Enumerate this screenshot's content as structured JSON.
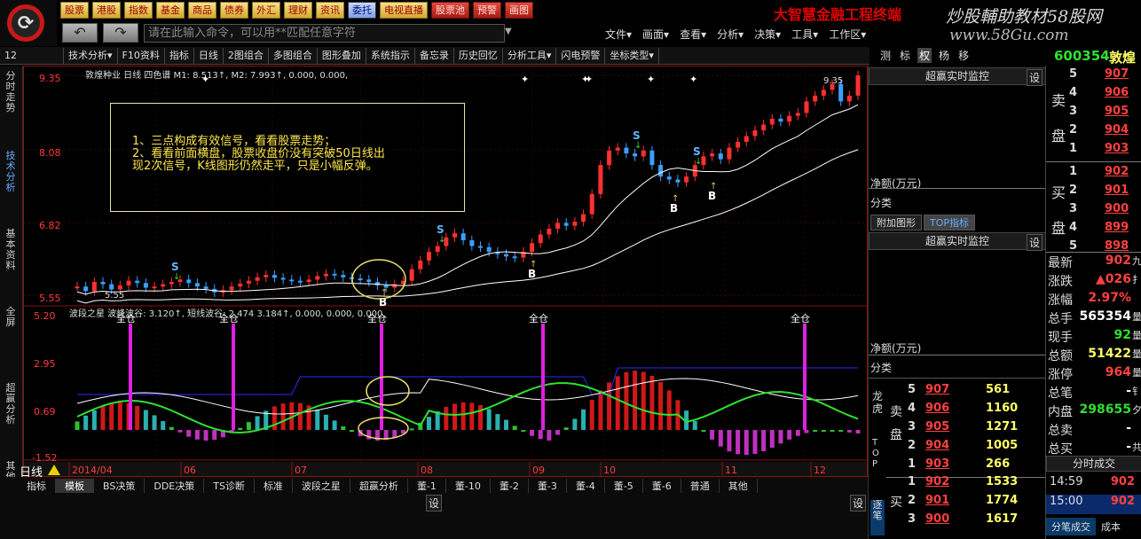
{
  "topmenu": [
    {
      "label": "股票",
      "style": "gold"
    },
    {
      "label": "港股",
      "style": "gold"
    },
    {
      "label": "指数",
      "style": "gold"
    },
    {
      "label": "基金",
      "style": "gold"
    },
    {
      "label": "商品",
      "style": "gold"
    },
    {
      "label": "债券",
      "style": "gold"
    },
    {
      "label": "外汇",
      "style": "gold"
    },
    {
      "label": "理财",
      "style": "gold"
    },
    {
      "label": "资讯",
      "style": "gold"
    },
    {
      "label": "委托",
      "style": "blue"
    },
    {
      "label": "电视直播",
      "style": "gold"
    },
    {
      "label": "股票池",
      "style": "red"
    },
    {
      "label": "预警",
      "style": "red"
    },
    {
      "label": "画图",
      "style": "red"
    }
  ],
  "brand": "大智慧金融工程终端",
  "watermark": "炒股輔助教材58股网",
  "watermark_url": "www.58Gu.com",
  "nav": {
    "back": "↶",
    "forward": "↷"
  },
  "command_placeholder": "请在此输入命令，可以用**匹配任意字符",
  "mainmenu": [
    "文件▾",
    "画面▾",
    "查看▾",
    "分析▾",
    "决策▾",
    "工具▾",
    "工作区▾"
  ],
  "toolbar": {
    "code": "12",
    "items": [
      "技术分析▾",
      "F10资料",
      "指标",
      "日线",
      "2图组合",
      "多图组合",
      "图形叠加",
      "系统指示",
      "备忘录",
      "历史回忆",
      "分析工具▾",
      "闪电预警",
      "坐标类型▾"
    ]
  },
  "right_tabs": [
    {
      "label": "测",
      "active": false
    },
    {
      "label": "标",
      "active": false
    },
    {
      "label": "权",
      "active": true
    },
    {
      "label": "杨",
      "active": false
    },
    {
      "label": "移",
      "active": false
    }
  ],
  "stock": {
    "code": "600354",
    "name": "敦煌"
  },
  "leftnav": [
    {
      "label": "分时走势",
      "active": false
    },
    {
      "label": "技术分析",
      "active": true
    },
    {
      "label": "基本资料",
      "active": false
    },
    {
      "label": "全屏",
      "active": false
    },
    {
      "label": "超赢分析",
      "active": false
    },
    {
      "label": "其他",
      "active": false
    }
  ],
  "chart": {
    "legend_main": "敦煌种业 日线 四色谱 M1: 8.513↑, M2: 7.993↑, 0.000, 0.000,",
    "legend_sub": "波段之星 波峰波谷: 3.120↑, 短线波谷:  2.474 3.184↑, 0.000, 0.000, 0.000,",
    "price_axis": [
      "9.35",
      "8.08",
      "6.82",
      "5.55"
    ],
    "sub_axis": [
      "5.20",
      "2.95",
      "0.69",
      "-1.52"
    ],
    "top_max": "9.35",
    "low_label": "5.55",
    "date_labels": [
      "2014/04",
      "06",
      "07",
      "08",
      "09",
      "10",
      "11",
      "12"
    ],
    "full_position": "全仓",
    "signal_s": "S",
    "signal_b": "B",
    "annotation": [
      "1、三点构成有效信号，看看股票走势；",
      "2、看看前面横盘，股票收盘价没有突破50日线出",
      "现2次信号，K线图形仍然走平，只是小幅反弹。"
    ]
  },
  "chart_data": {
    "type": "candlestick",
    "ylim": [
      5.55,
      9.35
    ],
    "closes": [
      5.7,
      5.62,
      5.78,
      5.74,
      5.65,
      5.72,
      5.8,
      5.76,
      5.68,
      5.7,
      5.74,
      5.78,
      5.82,
      5.76,
      5.7,
      5.66,
      5.6,
      5.64,
      5.7,
      5.75,
      5.8,
      5.86,
      5.9,
      5.85,
      5.82,
      5.8,
      5.78,
      5.82,
      5.88,
      5.92,
      5.9,
      5.86,
      5.84,
      5.82,
      5.78,
      5.72,
      5.68,
      5.74,
      5.8,
      6.0,
      6.15,
      6.3,
      6.4,
      6.55,
      6.62,
      6.5,
      6.4,
      6.38,
      6.3,
      6.26,
      6.22,
      6.2,
      6.3,
      6.45,
      6.6,
      6.7,
      6.8,
      6.75,
      6.82,
      6.95,
      7.3,
      7.8,
      8.05,
      8.1,
      8.0,
      7.95,
      8.05,
      7.8,
      7.6,
      7.55,
      7.5,
      7.6,
      7.8,
      7.95,
      8.0,
      7.9,
      8.1,
      8.2,
      8.3,
      8.4,
      8.5,
      8.6,
      8.55,
      8.65,
      8.7,
      8.9,
      9.0,
      9.1,
      9.2,
      8.9,
      9.0,
      9.35
    ]
  },
  "bottom_tabs": [
    "指标",
    "模板",
    "BS决策",
    "DDE决策",
    "TS诊断",
    "标准",
    "波段之星",
    "超赢分析",
    "董-1",
    "董-10",
    "董-2",
    "董-3",
    "董-4",
    "董-5",
    "董-6",
    "普通",
    "其他"
  ],
  "bottom_tab_active": "模板",
  "day_label": "日线",
  "gear": "设",
  "monitor": {
    "title": "超赢实时监控",
    "net_label": "净额(万元)",
    "class_label": "分类",
    "tabs": [
      "附加图形",
      "TOP指标"
    ]
  },
  "dragon": {
    "label": "龙虎",
    "top_label": "TOP",
    "sell_label": "卖盘",
    "buy_label": "买",
    "sell": [
      {
        "lvl": "5",
        "price": "907",
        "vol": "561"
      },
      {
        "lvl": "4",
        "price": "906",
        "vol": "1160"
      },
      {
        "lvl": "3",
        "price": "905",
        "vol": "1271"
      },
      {
        "lvl": "2",
        "price": "904",
        "vol": "1005"
      },
      {
        "lvl": "1",
        "price": "903",
        "vol": "266"
      }
    ],
    "buy": [
      {
        "lvl": "1",
        "price": "902",
        "vol": "1533"
      },
      {
        "lvl": "2",
        "price": "901",
        "vol": "1774"
      },
      {
        "lvl": "3",
        "price": "900",
        "vol": "1617"
      }
    ],
    "trans_label": "逐笔"
  },
  "side": {
    "sell_label": "卖盘",
    "buy_label": "买盘",
    "sell": [
      {
        "lvl": "5",
        "price": "907"
      },
      {
        "lvl": "4",
        "price": "906"
      },
      {
        "lvl": "3",
        "price": "905"
      },
      {
        "lvl": "2",
        "price": "904"
      },
      {
        "lvl": "1",
        "price": "903"
      }
    ],
    "buy": [
      {
        "lvl": "1",
        "price": "902"
      },
      {
        "lvl": "2",
        "price": "901"
      },
      {
        "lvl": "3",
        "price": "900"
      },
      {
        "lvl": "4",
        "price": "899"
      },
      {
        "lvl": "5",
        "price": "898"
      }
    ],
    "stats": [
      {
        "label": "最新",
        "value": "902",
        "tail": "九",
        "color": "red"
      },
      {
        "label": "涨跌",
        "value": "▲026",
        "tail": "扌",
        "color": "red"
      },
      {
        "label": "涨幅",
        "value": "2.97%",
        "tail": "",
        "color": "red"
      },
      {
        "label": "总手",
        "value": "565354",
        "tail": "量",
        "color": "white"
      },
      {
        "label": "现手",
        "value": "92",
        "tail": "量",
        "color": "green"
      },
      {
        "label": "总额",
        "value": "51422",
        "tail": "量",
        "color": "yellow"
      },
      {
        "label": "涨停",
        "value": "964",
        "tail": "量",
        "color": "red"
      },
      {
        "label": "总笔",
        "value": "-",
        "tail": "钅",
        "color": "white"
      },
      {
        "label": "内盘",
        "value": "298655",
        "tail": "夕",
        "color": "green"
      },
      {
        "label": "总卖",
        "value": "-",
        "tail": "",
        "color": "white"
      },
      {
        "label": "总买",
        "value": "-",
        "tail": "共",
        "color": "white"
      }
    ],
    "tick_title": "分时成交",
    "ticks": [
      {
        "time": "14:59",
        "price": "902"
      },
      {
        "time": "15:00",
        "price": "902"
      }
    ],
    "bottom_tabs": [
      "分笔成交",
      "成本"
    ]
  }
}
